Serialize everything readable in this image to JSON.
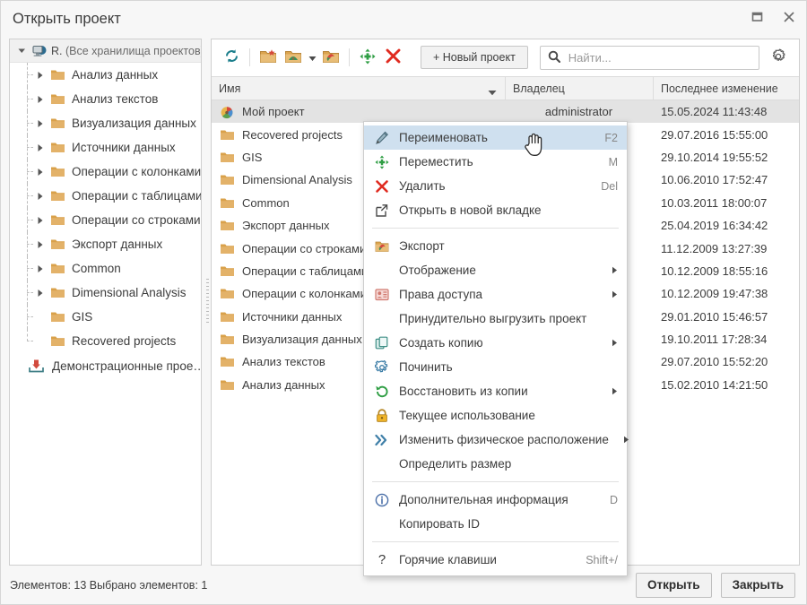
{
  "window": {
    "title": "Открыть проект",
    "maximize_icon": "maximize-icon",
    "close_icon": "close-icon"
  },
  "sidebar": {
    "root": {
      "prefix": "R.",
      "label": "(Все хранилища проектов)",
      "icon": "repository-icon",
      "expander": "chevron-down-icon"
    },
    "items": [
      {
        "label": "Анализ данных",
        "icon": "folder-icon",
        "expandable": true
      },
      {
        "label": "Анализ текстов",
        "icon": "folder-icon",
        "expandable": true
      },
      {
        "label": "Визуализация данных",
        "icon": "folder-icon",
        "expandable": true
      },
      {
        "label": "Источники данных",
        "icon": "folder-icon",
        "expandable": true
      },
      {
        "label": "Операции с колонками",
        "icon": "folder-icon",
        "expandable": true
      },
      {
        "label": "Операции с таблицами",
        "icon": "folder-icon",
        "expandable": true
      },
      {
        "label": "Операции со строками",
        "icon": "folder-icon",
        "expandable": true
      },
      {
        "label": "Экспорт данных",
        "icon": "folder-icon",
        "expandable": true
      },
      {
        "label": "Common",
        "icon": "folder-icon",
        "expandable": true
      },
      {
        "label": "Dimensional Analysis",
        "icon": "folder-icon",
        "expandable": true
      },
      {
        "label": "GIS",
        "icon": "folder-icon",
        "expandable": false
      },
      {
        "label": "Recovered projects",
        "icon": "folder-icon",
        "expandable": false
      }
    ],
    "demo": {
      "label": "Демонстрационные прое…",
      "icon": "import-tray-icon"
    }
  },
  "toolbar": {
    "buttons": [
      {
        "name": "refresh-button",
        "icon": "refresh-icon"
      },
      {
        "name": "new-folder-button",
        "icon": "new-folder-icon"
      },
      {
        "name": "import-button",
        "icon": "import-folder-icon",
        "has_caret": true
      },
      {
        "name": "export-button",
        "icon": "export-folder-icon"
      },
      {
        "name": "move-button",
        "icon": "move-arrows-icon"
      },
      {
        "name": "delete-button",
        "icon": "delete-x-icon"
      }
    ],
    "new_project_label": "+ Новый проект",
    "search_placeholder": "Найти...",
    "search_value": "",
    "search_icon": "search-icon",
    "settings_icon": "gear-icon"
  },
  "table": {
    "columns": [
      {
        "key": "name",
        "label": "Имя",
        "sorted": true,
        "sort_icon": "sort-desc-icon"
      },
      {
        "key": "owner",
        "label": "Владелец",
        "sorted": false
      },
      {
        "key": "mod",
        "label": "Последнее изменение",
        "sorted": false
      }
    ],
    "rows": [
      {
        "name": "Мой проект",
        "icon": "project-icon",
        "owner": "administrator",
        "mod": "15.05.2024 11:43:48",
        "selected": true
      },
      {
        "name": "Recovered projects",
        "icon": "folder-icon",
        "owner": "",
        "mod": "29.07.2016 15:55:00",
        "selected": false
      },
      {
        "name": "GIS",
        "icon": "folder-icon",
        "owner": "",
        "mod": "29.10.2014 19:55:52",
        "selected": false
      },
      {
        "name": "Dimensional Analysis",
        "icon": "folder-icon",
        "owner": "",
        "mod": "10.06.2010 17:52:47",
        "selected": false
      },
      {
        "name": "Common",
        "icon": "folder-icon",
        "owner": "",
        "mod": "10.03.2011 18:00:07",
        "selected": false
      },
      {
        "name": "Экспорт данных",
        "icon": "folder-icon",
        "owner": "",
        "mod": "25.04.2019 16:34:42",
        "selected": false
      },
      {
        "name": "Операции со строками",
        "icon": "folder-icon",
        "owner": "",
        "mod": "11.12.2009 13:27:39",
        "selected": false
      },
      {
        "name": "Операции с таблицами",
        "icon": "folder-icon",
        "owner": "",
        "mod": "10.12.2009 18:55:16",
        "selected": false
      },
      {
        "name": "Операции с колонками",
        "icon": "folder-icon",
        "owner": "",
        "mod": "10.12.2009 19:47:38",
        "selected": false
      },
      {
        "name": "Источники данных",
        "icon": "folder-icon",
        "owner": "",
        "mod": "29.01.2010 15:46:57",
        "selected": false
      },
      {
        "name": "Визуализация данных",
        "icon": "folder-icon",
        "owner": "",
        "mod": "19.10.2011 17:28:34",
        "selected": false
      },
      {
        "name": "Анализ текстов",
        "icon": "folder-icon",
        "owner": "",
        "mod": "29.07.2010 15:52:20",
        "selected": false
      },
      {
        "name": "Анализ данных",
        "icon": "folder-icon",
        "owner": "",
        "mod": "15.02.2010 14:21:50",
        "selected": false
      }
    ]
  },
  "context_menu": {
    "items": [
      {
        "type": "item",
        "label": "Переименовать",
        "accel": "F2",
        "icon": "pencil-icon",
        "active": true,
        "submenu": false
      },
      {
        "type": "item",
        "label": "Переместить",
        "accel": "M",
        "icon": "move-arrows-icon",
        "active": false,
        "submenu": false
      },
      {
        "type": "item",
        "label": "Удалить",
        "accel": "Del",
        "icon": "delete-x-icon",
        "active": false,
        "submenu": false
      },
      {
        "type": "item",
        "label": "Открыть в новой вкладке",
        "accel": "",
        "icon": "external-link-icon",
        "active": false,
        "submenu": false
      },
      {
        "type": "sep"
      },
      {
        "type": "item",
        "label": "Экспорт",
        "accel": "",
        "icon": "export-folder-icon",
        "active": false,
        "submenu": false
      },
      {
        "type": "item",
        "label": "Отображение",
        "accel": "",
        "icon": "",
        "active": false,
        "submenu": true
      },
      {
        "type": "item",
        "label": "Права доступа",
        "accel": "",
        "icon": "permissions-icon",
        "active": false,
        "submenu": true
      },
      {
        "type": "item",
        "label": "Принудительно выгрузить проект",
        "accel": "",
        "icon": "",
        "active": false,
        "submenu": false
      },
      {
        "type": "item",
        "label": "Создать копию",
        "accel": "",
        "icon": "copy-icon",
        "active": false,
        "submenu": true
      },
      {
        "type": "item",
        "label": "Починить",
        "accel": "",
        "icon": "repair-gear-icon",
        "active": false,
        "submenu": false
      },
      {
        "type": "item",
        "label": "Восстановить из копии",
        "accel": "",
        "icon": "restore-icon",
        "active": false,
        "submenu": true
      },
      {
        "type": "item",
        "label": "Текущее использование",
        "accel": "",
        "icon": "lock-icon",
        "active": false,
        "submenu": false
      },
      {
        "type": "item",
        "label": "Изменить физическое расположение",
        "accel": "",
        "icon": "double-chevron-icon",
        "active": false,
        "submenu": true
      },
      {
        "type": "item",
        "label": "Определить размер",
        "accel": "",
        "icon": "",
        "active": false,
        "submenu": false
      },
      {
        "type": "sep"
      },
      {
        "type": "item",
        "label": "Дополнительная информация",
        "accel": "D",
        "icon": "info-icon",
        "active": false,
        "submenu": false
      },
      {
        "type": "item",
        "label": "Копировать ID",
        "accel": "",
        "icon": "",
        "active": false,
        "submenu": false
      },
      {
        "type": "sep"
      },
      {
        "type": "item",
        "label": "Горячие клавиши",
        "accel": "Shift+/",
        "icon": "question-icon",
        "active": false,
        "submenu": false
      }
    ]
  },
  "statusbar": {
    "text": "Элементов: 13  Выбрано элементов: 1",
    "open_label": "Открыть",
    "close_label": "Закрыть"
  },
  "colors": {
    "folder": "#d9a14a",
    "accent_selected_menu": "#cfe0ef",
    "row_selected": "#e3e3e3",
    "delete_red": "#e02b20",
    "move_green": "#2f9e44",
    "refresh_teal": "#1d7f8c"
  }
}
